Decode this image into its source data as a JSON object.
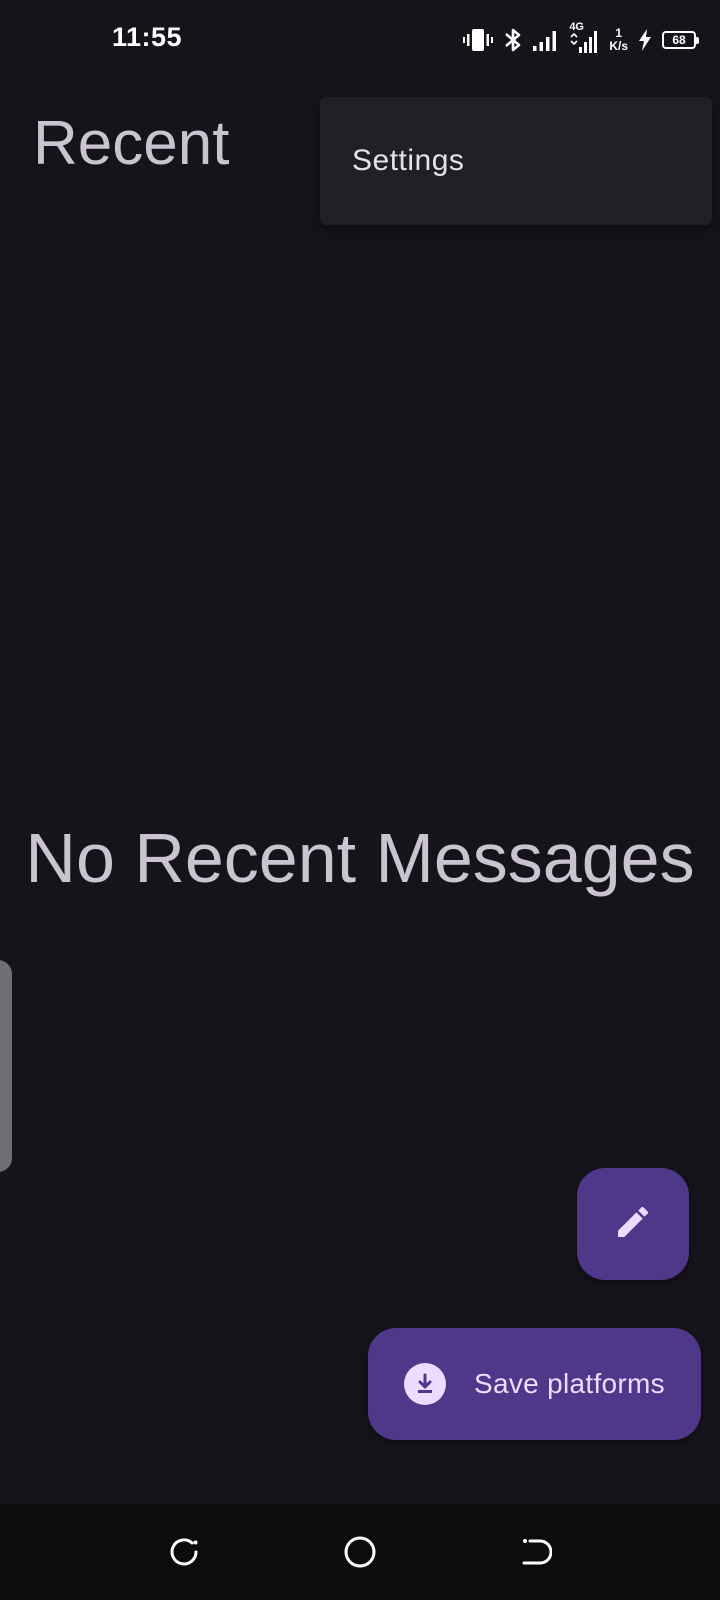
{
  "status_bar": {
    "time": "11:55",
    "network_type": "4G",
    "net_speed_value": "1",
    "net_speed_unit": "K/s",
    "battery_level": "68",
    "icons": [
      "vibrate-icon",
      "bluetooth-icon",
      "signal-icon",
      "signal-4g-icon",
      "charging-icon",
      "battery-icon"
    ]
  },
  "header": {
    "title": "Recent"
  },
  "overflow_menu": {
    "items": [
      {
        "label": "Settings"
      }
    ]
  },
  "main": {
    "empty_message": "No Recent Messages"
  },
  "fab_compose": {
    "icon": "pencil-icon"
  },
  "fab_save": {
    "label": "Save platforms",
    "icon": "download-icon"
  },
  "nav_bar": {
    "buttons": [
      "recents-icon",
      "home-icon",
      "back-icon"
    ]
  },
  "colors": {
    "background": "#16141b",
    "menu_surface": "#211f26",
    "fab": "#4f378a",
    "fab_content": "#eaddff",
    "text_secondary": "#cac4d0"
  }
}
